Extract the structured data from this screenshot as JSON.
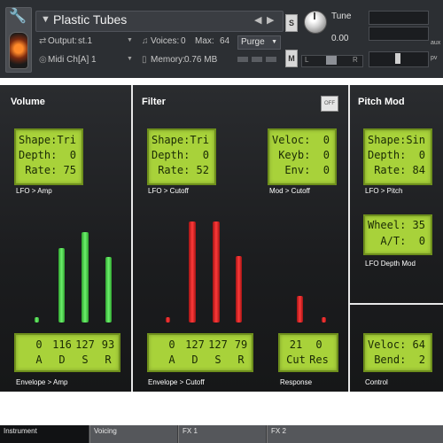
{
  "header": {
    "instrument_name": "Plastic Tubes",
    "output_label": "Output:",
    "output_value": "st.1",
    "voices_label": "Voices:",
    "voices_value": "0",
    "max_label": "Max:",
    "max_value": "64",
    "purge_label": "Purge",
    "midi_label": "Midi Ch:",
    "midi_value": "[A] 1",
    "memory_label": "Memory:",
    "memory_value": "0.76 MB",
    "solo_label": "S",
    "mute_label": "M",
    "tune_label": "Tune",
    "tune_value": "0.00",
    "pan_left": "L",
    "pan_right": "R",
    "aux_label": "aux",
    "pv_label": "pv"
  },
  "volume": {
    "title": "Volume",
    "lfo": {
      "shape": "Shape:Tri",
      "depth": "Depth:  0",
      "rate": "Rate: 75"
    },
    "lfo_caption": "LFO > Amp",
    "envelope": {
      "values": [
        "0",
        "116",
        "127",
        "93"
      ],
      "letters": [
        "A",
        "D",
        "S",
        "R"
      ]
    },
    "envelope_levels": [
      0.04,
      0.56,
      0.68,
      0.49
    ],
    "envelope_caption": "Envelope > Amp"
  },
  "filter": {
    "title": "Filter",
    "off_label": "OFF",
    "lfo": {
      "shape": "Shape:Tri",
      "depth": "Depth:  0",
      "rate": "Rate: 52"
    },
    "lfo_caption": "LFO > Cutoff",
    "mod": {
      "veloc": "Veloc:  0",
      "keyb": "Keyb:  0",
      "env": "Env:  0"
    },
    "mod_caption": "Mod > Cutoff",
    "envelope": {
      "values": [
        "0",
        "127",
        "127",
        "79"
      ],
      "letters": [
        "A",
        "D",
        "S",
        "R"
      ]
    },
    "envelope_levels": [
      0.04,
      0.76,
      0.76,
      0.5
    ],
    "envelope_caption": "Envelope > Cutoff",
    "response": {
      "values": [
        "21",
        "0"
      ],
      "letters": [
        "Cut",
        "Res"
      ]
    },
    "response_levels": [
      0.2,
      0.04
    ],
    "response_caption": "Response"
  },
  "pitch_mod": {
    "title": "Pitch Mod",
    "lfo": {
      "shape": "Shape:Sin",
      "depth": "Depth:  0",
      "rate": "Rate: 84"
    },
    "lfo_caption": "LFO > Pitch",
    "depth_mod": {
      "wheel": "Wheel: 35",
      "at": "A/T:  0"
    },
    "depth_mod_caption": "LFO Depth Mod",
    "control": {
      "veloc": "Veloc: 64",
      "bend": "Bend:  2"
    },
    "control_caption": "Control"
  },
  "tabs": [
    "Instrument",
    "Voicing",
    "FX 1",
    "FX 2"
  ],
  "colors": {
    "lcd": "#a8d23a",
    "amp_bar": "#4fd94f",
    "filter_bar": "#e02020"
  }
}
